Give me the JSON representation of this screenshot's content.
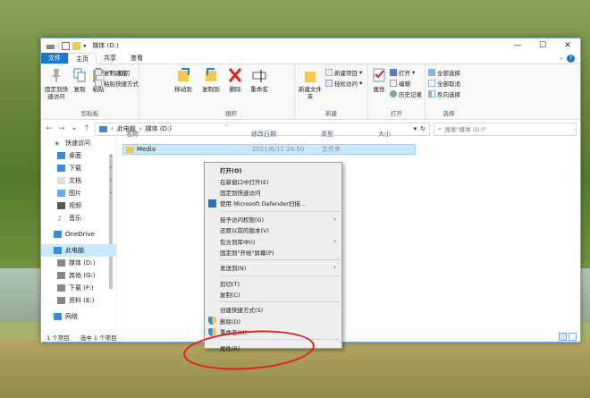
{
  "window": {
    "title": "媒体 (D:)",
    "controls": {
      "minimize": "—",
      "maximize": "☐",
      "close": "✕"
    }
  },
  "tabs": [
    "文件",
    "主页",
    "共享",
    "查看"
  ],
  "ribbon": {
    "clipboard": {
      "name": "剪贴板",
      "pin": "固定到快速访问",
      "copy": "复制",
      "paste": "粘贴",
      "cut": "剪切",
      "copy_path": "复制路径",
      "paste_shortcut": "粘贴快捷方式"
    },
    "organize": {
      "name": "组织",
      "move_to": "移动到",
      "copy_to": "复制到",
      "delete": "删除",
      "rename": "重命名"
    },
    "new": {
      "name": "新建",
      "new_folder": "新建文件夹",
      "new_item": "新建项目",
      "easy_access": "轻松访问"
    },
    "open": {
      "name": "打开",
      "properties": "属性",
      "open": "打开",
      "edit": "编辑",
      "history": "历史记录"
    },
    "select": {
      "name": "选择",
      "select_all": "全部选择",
      "select_none": "全部取消",
      "invert": "反向选择"
    }
  },
  "address": {
    "back": "←",
    "forward": "→",
    "up": "↑",
    "crumb_pc": "此电脑",
    "crumb_drive": "媒体 (D:)",
    "search_placeholder": "搜索\"媒体 (D:)\""
  },
  "nav_pane": [
    {
      "label": "快速访问",
      "icon": "star-icon"
    },
    {
      "label": "桌面",
      "icon": "desktop-icon",
      "pinned": true
    },
    {
      "label": "下载",
      "icon": "download-icon",
      "pinned": true
    },
    {
      "label": "文档",
      "icon": "document-icon",
      "pinned": true
    },
    {
      "label": "图片",
      "icon": "picture-icon",
      "pinned": true
    },
    {
      "label": "视频",
      "icon": "video-icon"
    },
    {
      "label": "音乐",
      "icon": "music-icon"
    },
    {
      "label": "OneDrive",
      "icon": "cloud-icon"
    },
    {
      "label": "此电脑",
      "icon": "computer-icon",
      "selected": true
    },
    {
      "label": "媒体 (D:)",
      "icon": "drive-icon"
    },
    {
      "label": "其他 (G:)",
      "icon": "drive-icon"
    },
    {
      "label": "下载 (F:)",
      "icon": "drive-icon"
    },
    {
      "label": "资料 (E:)",
      "icon": "drive-icon"
    },
    {
      "label": "网络",
      "icon": "network-icon"
    }
  ],
  "columns": [
    "名称",
    "修改日期",
    "类型",
    "大小"
  ],
  "files": [
    {
      "name": "Media",
      "modified": "2021/6/11 20:50",
      "type": "文件夹",
      "size": ""
    }
  ],
  "status": {
    "count": "1 个项目",
    "selected": "选中 1 个项目"
  },
  "context_menu": [
    {
      "label": "打开(O)",
      "bold": true
    },
    {
      "label": "在新窗口中打开(E)"
    },
    {
      "label": "固定到快速访问"
    },
    {
      "label": "使用 Microsoft Defender扫描...",
      "icon": "defender-icon"
    },
    {
      "sep": true
    },
    {
      "label": "授予访问权限(G)",
      "arrow": true
    },
    {
      "label": "还原以前的版本(V)"
    },
    {
      "label": "包含到库中(I)",
      "arrow": true
    },
    {
      "label": "固定到\"开始\"屏幕(P)"
    },
    {
      "sep": true
    },
    {
      "label": "发送到(N)",
      "arrow": true
    },
    {
      "sep": true
    },
    {
      "label": "剪切(T)"
    },
    {
      "label": "复制(C)"
    },
    {
      "sep": true
    },
    {
      "label": "创建快捷方式(S)"
    },
    {
      "label": "删除(D)",
      "icon": "shield-icon"
    },
    {
      "label": "重命名(M)",
      "icon": "shield-icon"
    },
    {
      "sep": true
    },
    {
      "label": "属性(R)"
    }
  ],
  "colors": {
    "accent": "#1979ca",
    "selection": "#cce8ff",
    "annotation": "#e0201c"
  }
}
